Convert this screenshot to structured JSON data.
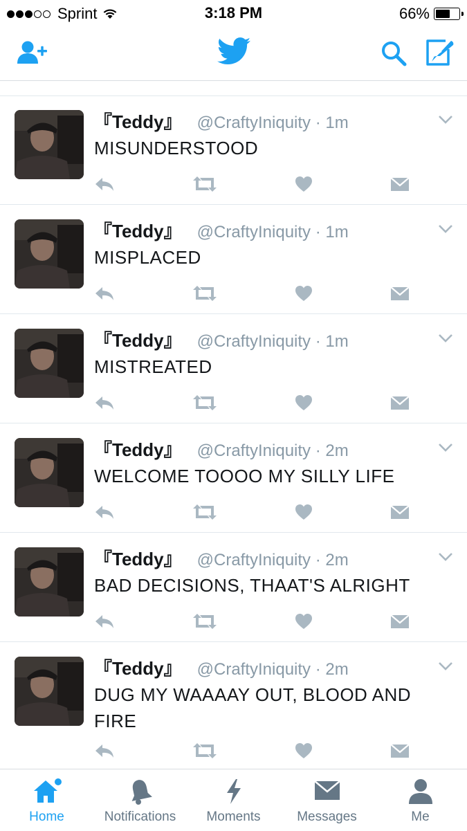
{
  "status_bar": {
    "carrier": "Sprint",
    "time": "3:18 PM",
    "battery_percent": "66%",
    "battery_level": 0.66,
    "signal_bars_filled": 3,
    "signal_bars_total": 5
  },
  "header": {
    "left_icon": "add-user-icon",
    "center_icon": "twitter-bird-logo",
    "right_icons": [
      "search-icon",
      "compose-icon"
    ],
    "accent_color": "#1da1f2"
  },
  "tweets": [
    {
      "name": "『Teddy』",
      "handle": "@CraftyIniquity · 1m",
      "text": "MISUNDERSTOOD"
    },
    {
      "name": "『Teddy』",
      "handle": "@CraftyIniquity · 1m",
      "text": "MISPLACED"
    },
    {
      "name": "『Teddy』",
      "handle": "@CraftyIniquity · 1m",
      "text": "MISTREATED"
    },
    {
      "name": "『Teddy』",
      "handle": "@CraftyIniquity · 2m",
      "text": "WELCOME TOOOO MY SILLY LIFE"
    },
    {
      "name": "『Teddy』",
      "handle": "@CraftyIniquity · 2m",
      "text": "BAD DECISIONS, THAAT'S ALRIGHT"
    },
    {
      "name": "『Teddy』",
      "handle": "@CraftyIniquity · 2m",
      "text": "DUG MY WAAAAY OUT, BLOOD AND FIRE"
    }
  ],
  "tweet_actions": [
    "reply-icon",
    "retweet-icon",
    "like-icon",
    "direct-message-icon"
  ],
  "tab_bar": {
    "tabs": [
      {
        "label": "Home",
        "icon": "home-icon",
        "active": true
      },
      {
        "label": "Notifications",
        "icon": "bell-icon",
        "active": false
      },
      {
        "label": "Moments",
        "icon": "lightning-icon",
        "active": false
      },
      {
        "label": "Messages",
        "icon": "envelope-icon",
        "active": false
      },
      {
        "label": "Me",
        "icon": "person-icon",
        "active": false
      }
    ]
  }
}
